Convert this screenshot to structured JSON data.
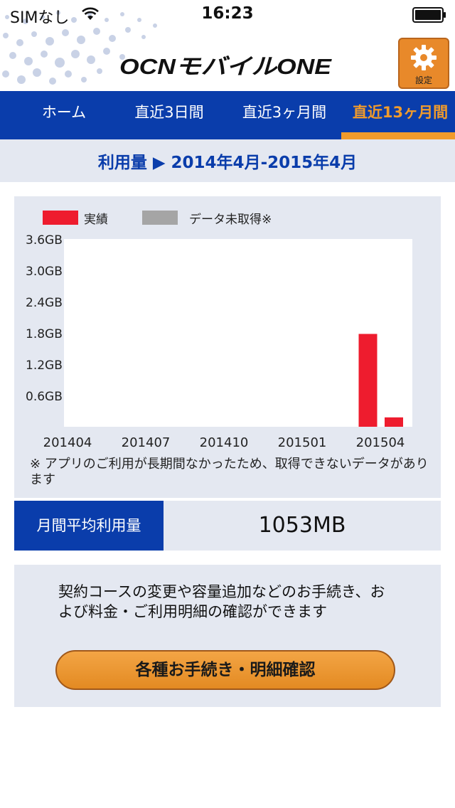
{
  "status_bar": {
    "carrier": "SIMなし",
    "time": "16:23"
  },
  "header": {
    "logo_text": "OCNモバイルONE",
    "settings_label": "設定",
    "brand_blue": "#0a3dab",
    "accent_orange": "#f19b2b"
  },
  "tabs": [
    {
      "label": "ホーム",
      "active": false
    },
    {
      "label": "直近3日間",
      "active": false
    },
    {
      "label": "直近3ヶ月間",
      "active": false
    },
    {
      "label": "直近13ヶ月間",
      "active": true
    }
  ],
  "period": {
    "text": "利用量 ▶ 2014年4月-2015年4月"
  },
  "legend": [
    {
      "label": "実績",
      "color": "#ee1c2e"
    },
    {
      "label": "データ未取得※",
      "color": "#a5a5a5"
    }
  ],
  "chart_data": {
    "type": "bar",
    "y_unit": "GB",
    "ylim": [
      0,
      3.6
    ],
    "y_ticks": [
      0.6,
      1.2,
      1.8,
      2.4,
      3.0,
      3.6
    ],
    "y_tick_labels": [
      "0.6GB",
      "1.2GB",
      "1.8GB",
      "2.4GB",
      "3.0GB",
      "3.6GB"
    ],
    "x_tick_labels": [
      "201404",
      "201407",
      "201410",
      "201501",
      "201504"
    ],
    "categories": [
      "201404",
      "201405",
      "201406",
      "201407",
      "201408",
      "201409",
      "201410",
      "201411",
      "201412",
      "201501",
      "201502",
      "201503",
      "201504"
    ],
    "series": [
      {
        "name": "実績",
        "color": "#ee1c2e",
        "values": [
          0,
          0,
          0,
          0,
          0,
          0,
          0,
          0,
          0,
          0,
          0,
          1.78,
          0.18
        ]
      }
    ]
  },
  "footnote": "※ アプリのご利用が長期間なかったため、取得できないデータがあります",
  "average": {
    "label": "月間平均利用量",
    "value": "1053MB"
  },
  "procedure": {
    "text": "契約コースの変更や容量追加などのお手続き、および料金・ご利用明細の確認ができます",
    "button_label": "各種お手続き・明細確認"
  }
}
